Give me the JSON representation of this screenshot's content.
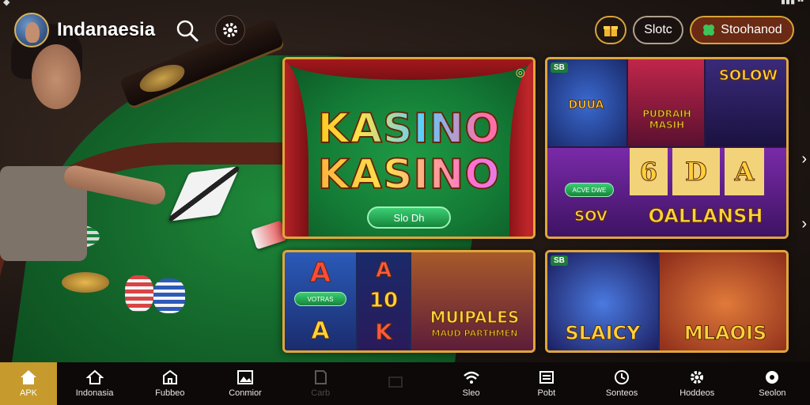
{
  "header": {
    "brand": "Indanaesia",
    "slots_label": "Slotc",
    "store_label": "Stoohanod"
  },
  "tiles": {
    "main": {
      "title_line1": "KASINO",
      "title_line2": "KASINO",
      "play_label": "Slo Dh"
    },
    "slot1": {
      "badge": "SB",
      "reel_top": "DUUA",
      "mid_title": "PUDRAIH MASIH",
      "top_right": "SOLOW",
      "mini_btn": "ACVE DWE",
      "reel_6": "6",
      "reel_d": "D",
      "reel_a": "A",
      "bottom_left": "SOV",
      "bottom_title": "OALLANSH"
    },
    "slot2": {
      "reel_a": "A",
      "reel_10": "10",
      "reel_k": "K",
      "reel_a2": "A",
      "mini_btn": "VOTRAS",
      "title": "MUIPALES",
      "subtitle": "MAUD PARTHMEN"
    },
    "slot3": {
      "badge": "SB",
      "left_title": "SLAICY",
      "right_title": "MLAOIS"
    }
  },
  "nav": [
    {
      "label": "APK",
      "icon": "home-icon"
    },
    {
      "label": "Indonasia",
      "icon": "house-icon"
    },
    {
      "label": "Fubbeo",
      "icon": "building-icon"
    },
    {
      "label": "Conmior",
      "icon": "image-icon"
    },
    {
      "label": "Carb",
      "icon": "card-icon"
    },
    {
      "label": "",
      "icon": "box-icon"
    },
    {
      "label": "Sleo",
      "icon": "wifi-icon"
    },
    {
      "label": "Pobt",
      "icon": "list-icon"
    },
    {
      "label": "Sonteos",
      "icon": "clock-icon"
    },
    {
      "label": "Hoddeos",
      "icon": "gear-icon"
    },
    {
      "label": "Seolon",
      "icon": "circle-icon"
    }
  ],
  "colors": {
    "accent_gold": "#c69a2c",
    "tile_border": "#e0a63a",
    "felt_green": "#137a35"
  }
}
